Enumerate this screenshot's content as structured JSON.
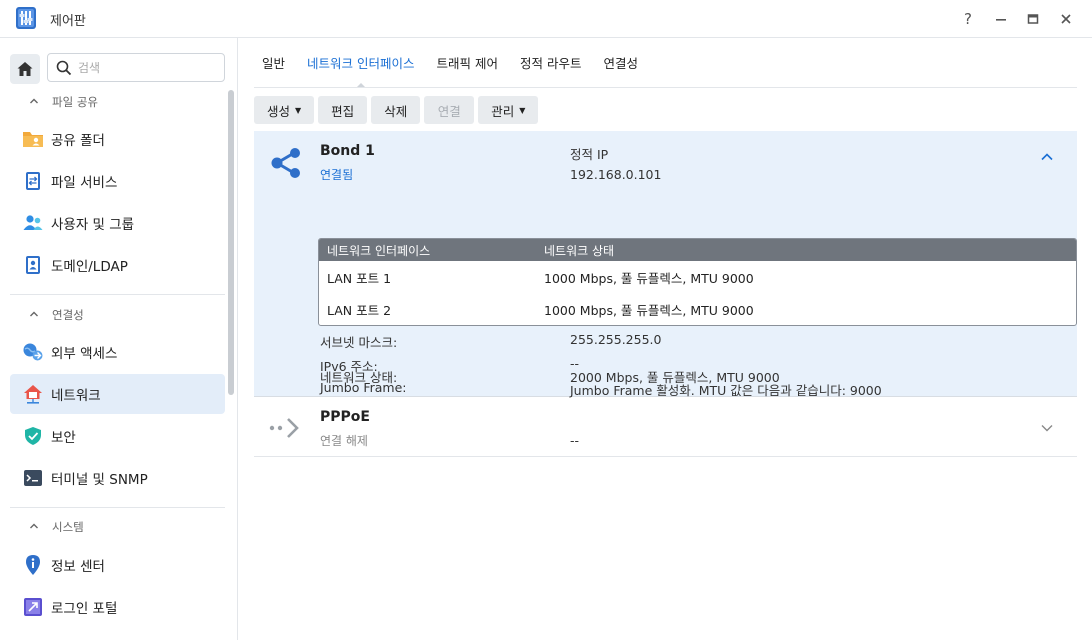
{
  "window": {
    "title": "제어판",
    "help": "?",
    "minimize": "—",
    "maximize": "▭",
    "close": "✕"
  },
  "sidebar": {
    "search_placeholder": "검색",
    "sections": [
      {
        "title": "파일 공유",
        "items": [
          "공유 폴더",
          "파일 서비스",
          "사용자 및 그룹",
          "도메인/LDAP"
        ]
      },
      {
        "title": "연결성",
        "items": [
          "외부 액세스",
          "네트워크",
          "보안",
          "터미널 및 SNMP"
        ]
      },
      {
        "title": "시스템",
        "items": [
          "정보 센터",
          "로그인 포털"
        ]
      }
    ],
    "active_item": "네트워크"
  },
  "tabs": [
    "일반",
    "네트워크 인터페이스",
    "트래픽 제어",
    "정적 라우트",
    "연결성"
  ],
  "active_tab": "네트워크 인터페이스",
  "toolbar": {
    "create": "생성",
    "edit": "편집",
    "delete": "삭제",
    "connect": "연결",
    "manage": "관리"
  },
  "interfaces": [
    {
      "name": "Bond 1",
      "status": "연결됨",
      "ip_type": "정적 IP",
      "ip": "192.168.0.101",
      "table": {
        "headers": [
          "네트워크 인터페이스",
          "네트워크 상태"
        ],
        "rows": [
          [
            "LAN 포트 1",
            "1000 Mbps, 풀 듀플렉스, MTU 9000"
          ],
          [
            "LAN 포트 2",
            "1000 Mbps, 풀 듀플렉스, MTU 9000"
          ]
        ]
      },
      "details": [
        {
          "label": "서브넷 마스크:",
          "value": "255.255.255.0"
        },
        {
          "label": "IPv6 주소:",
          "value": "--"
        },
        {
          "label": "Jumbo Frame:",
          "value": "Jumbo Frame 활성화. MTU 값은 다음과 같습니다: 9000"
        },
        {
          "label": "네트워크 상태:",
          "value": "2000 Mbps, 풀 듀플렉스, MTU 9000"
        }
      ]
    },
    {
      "name": "PPPoE",
      "status": "연결 해제",
      "ip": "--"
    }
  ],
  "colors": {
    "accent": "#1a6fd4",
    "connected": "#1a6fd4",
    "disconnected": "#888888",
    "selected_bg": "#e8f1fb"
  }
}
